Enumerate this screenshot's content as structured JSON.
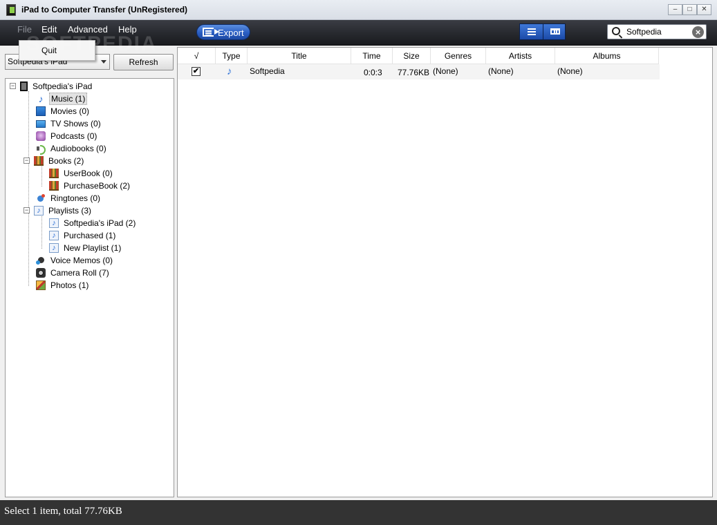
{
  "window": {
    "title": "iPad to Computer Transfer (UnRegistered)",
    "controls": [
      "–",
      "□",
      "✕"
    ]
  },
  "menubar": {
    "items": [
      {
        "label": "File",
        "dimmed": true
      },
      {
        "label": "Edit"
      },
      {
        "label": "Advanced"
      },
      {
        "label": "Help"
      }
    ],
    "file_menu": {
      "items": [
        "Quit"
      ]
    },
    "watermark": "SOFTPEDIA"
  },
  "toolbar": {
    "export_label": "Export",
    "export_icon": "export-icon",
    "view_buttons": [
      "list-view-icon",
      "grid-view-icon"
    ],
    "search": {
      "value": "Softpedia",
      "icon": "search-icon",
      "clear_icon": "clear-icon"
    }
  },
  "left_panel": {
    "device_select": {
      "value": "Softpedia's iPad"
    },
    "refresh_label": "Refresh",
    "tree": [
      {
        "label": "Softpedia's iPad",
        "icon": "ipad-icon",
        "level": 0,
        "expander": "−"
      },
      {
        "label": "Music (1)",
        "icon": "music-icon",
        "level": 1,
        "selected": true
      },
      {
        "label": "Movies (0)",
        "icon": "movie-icon",
        "level": 1
      },
      {
        "label": "TV Shows (0)",
        "icon": "tv-icon",
        "level": 1
      },
      {
        "label": "Podcasts (0)",
        "icon": "podcast-icon",
        "level": 1
      },
      {
        "label": "Audiobooks (0)",
        "icon": "audiobook-icon",
        "level": 1
      },
      {
        "label": "Books (2)",
        "icon": "books-icon",
        "level": 1,
        "expander": "−"
      },
      {
        "label": "UserBook (0)",
        "icon": "books-icon",
        "level": 2
      },
      {
        "label": "PurchaseBook (2)",
        "icon": "books-icon",
        "level": 2
      },
      {
        "label": "Ringtones (0)",
        "icon": "ringtone-icon",
        "level": 1
      },
      {
        "label": "Playlists (3)",
        "icon": "playlist-icon",
        "level": 1,
        "expander": "−"
      },
      {
        "label": "Softpedia's iPad (2)",
        "icon": "playlist-icon",
        "level": 2
      },
      {
        "label": "Purchased (1)",
        "icon": "playlist-icon",
        "level": 2
      },
      {
        "label": "New Playlist (1)",
        "icon": "playlist-icon",
        "level": 2
      },
      {
        "label": "Voice Memos (0)",
        "icon": "voice-memo-icon",
        "level": 1
      },
      {
        "label": "Camera Roll (7)",
        "icon": "camera-icon",
        "level": 1
      },
      {
        "label": "Photos (1)",
        "icon": "photos-icon",
        "level": 1
      }
    ]
  },
  "table": {
    "columns": [
      "√",
      "Type",
      "Title",
      "Time",
      "Size",
      "Genres",
      "Artists",
      "Albums"
    ],
    "rows": [
      {
        "checked": "✔",
        "type_icon": "music-note-icon",
        "title": "Softpedia",
        "time": "0:0:3",
        "size": "77.76KB",
        "genres": "(None)",
        "artists": "(None)",
        "albums": "(None)"
      }
    ]
  },
  "status": {
    "text": "Select 1 item, total 77.76KB"
  },
  "colors": {
    "toolbar_bg": "#25272c",
    "accent_blue": "#2a5dc2",
    "status_bg": "#333333"
  }
}
